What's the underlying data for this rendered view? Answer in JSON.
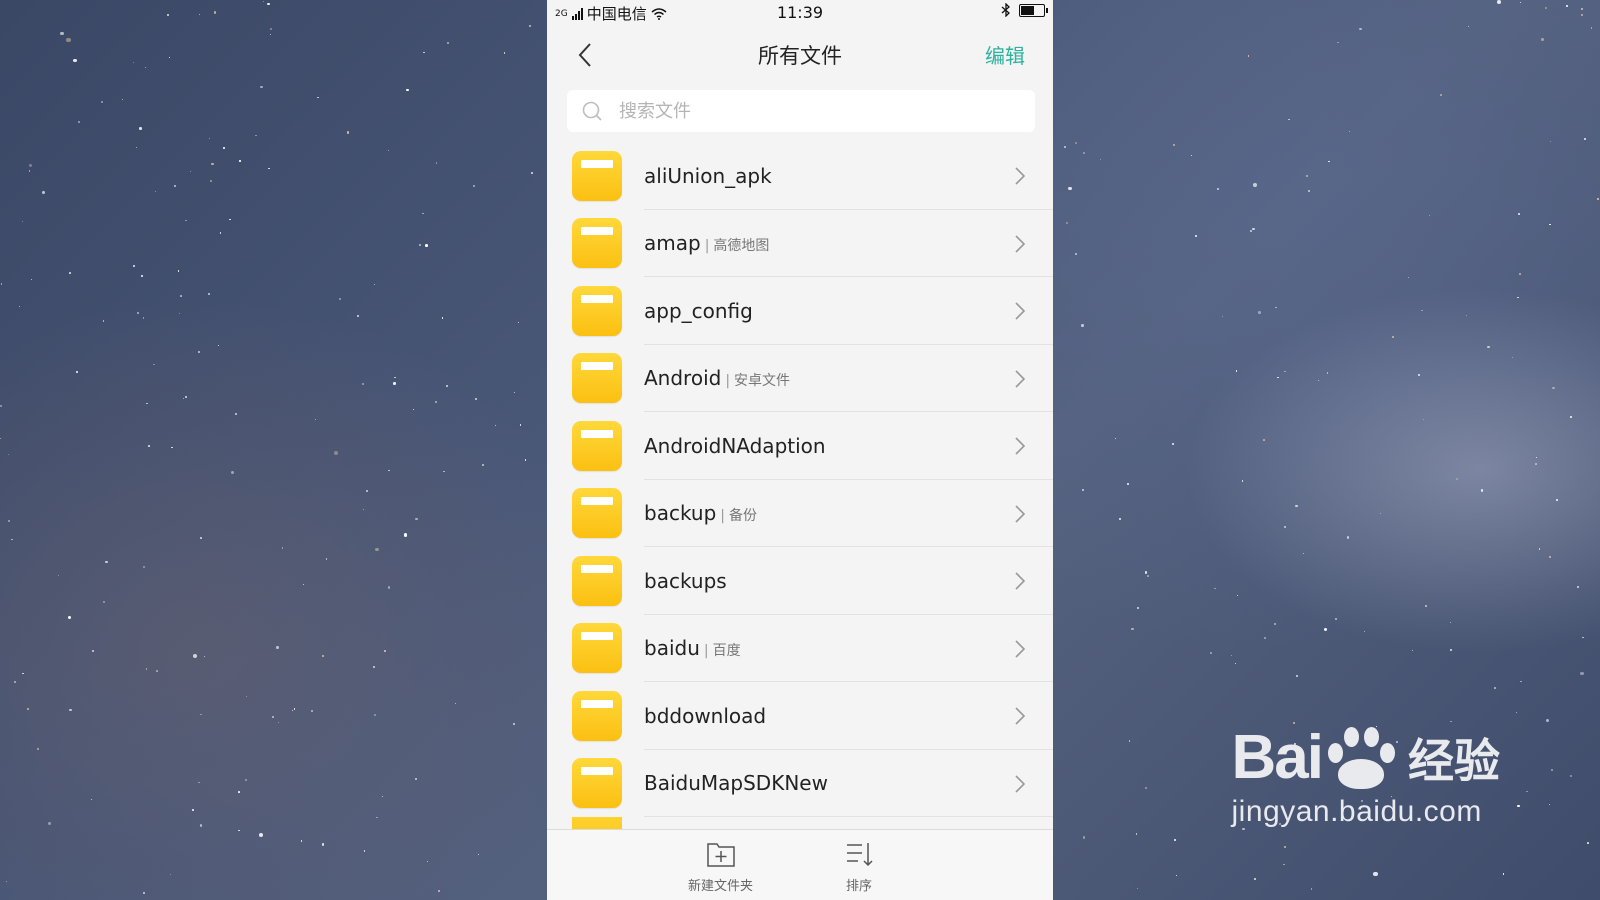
{
  "status_bar": {
    "network_type": "2G",
    "carrier": "中国电信",
    "time": "11:39",
    "icons": [
      "signal-icon",
      "wifi-icon",
      "bluetooth-icon",
      "battery-charging-icon"
    ]
  },
  "nav": {
    "title": "所有文件",
    "edit_label": "编辑",
    "back_icon": "chevron-left-icon"
  },
  "search": {
    "placeholder": "搜索文件",
    "value": ""
  },
  "folders": [
    {
      "name": "aliUnion_apk",
      "note": ""
    },
    {
      "name": "amap",
      "note": "高德地图"
    },
    {
      "name": "app_config",
      "note": ""
    },
    {
      "name": "Android",
      "note": "安卓文件"
    },
    {
      "name": "AndroidNAdaption",
      "note": ""
    },
    {
      "name": "backup",
      "note": "备份"
    },
    {
      "name": "backups",
      "note": ""
    },
    {
      "name": "baidu",
      "note": "百度"
    },
    {
      "name": "bddownload",
      "note": ""
    },
    {
      "name": "BaiduMapSDKNew",
      "note": ""
    }
  ],
  "bottom_bar": {
    "new_folder_label": "新建文件夹",
    "sort_label": "排序"
  },
  "watermark": {
    "brand_left": "Bai",
    "brand_right": "经验",
    "url": "jingyan.baidu.com"
  },
  "colors": {
    "accent": "#2fb39f",
    "folder": "#fcc419",
    "background": "#f4f4f4"
  }
}
